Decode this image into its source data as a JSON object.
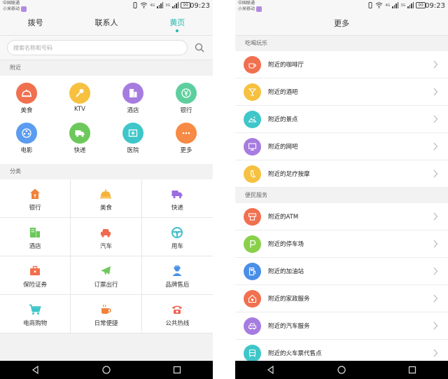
{
  "status_bar": {
    "carrier_line1": "中国联通",
    "carrier_line2": "小米移动",
    "network_tag_1": "4G",
    "network_tag_2": "3G",
    "battery": "99",
    "time": "09:23"
  },
  "left_screen": {
    "tabs": [
      {
        "label": "拨号",
        "active": false
      },
      {
        "label": "联系人",
        "active": false
      },
      {
        "label": "黄页",
        "active": true
      }
    ],
    "search": {
      "placeholder": "搜索名称和号码"
    },
    "nearby_section_title": "附近",
    "nearby_items": [
      {
        "label": "美食",
        "icon": "food-cover-icon",
        "color": "#f0704f"
      },
      {
        "label": "KTV",
        "icon": "microphone-icon",
        "color": "#f6c140"
      },
      {
        "label": "酒店",
        "icon": "hotel-building-icon",
        "color": "#a67ce0"
      },
      {
        "label": "银行",
        "icon": "yen-coin-icon",
        "color": "#5dcf9e"
      },
      {
        "label": "电影",
        "icon": "film-reel-icon",
        "color": "#5b9cf0"
      },
      {
        "label": "快递",
        "icon": "delivery-truck-icon",
        "color": "#6cc85a"
      },
      {
        "label": "医院",
        "icon": "medical-kit-icon",
        "color": "#3fc6c9"
      },
      {
        "label": "更多",
        "icon": "more-dots-icon",
        "color": "#f78a45"
      }
    ],
    "category_section_title": "分类",
    "categories": [
      {
        "label": "银行",
        "icon": "bank-house-icon",
        "color": "#f0823a"
      },
      {
        "label": "美食",
        "icon": "food-cover-icon",
        "color": "#f6b33a"
      },
      {
        "label": "快递",
        "icon": "delivery-truck-icon",
        "color": "#9a6de0"
      },
      {
        "label": "酒店",
        "icon": "hotel-building-icon",
        "color": "#6cc85a"
      },
      {
        "label": "汽车",
        "icon": "car-icon",
        "color": "#f06a4f"
      },
      {
        "label": "用车",
        "icon": "steering-wheel-icon",
        "color": "#3fbfc9"
      },
      {
        "label": "保险证券",
        "icon": "briefcase-icon",
        "color": "#f0704f"
      },
      {
        "label": "订票出行",
        "icon": "airplane-icon",
        "color": "#6cc85a"
      },
      {
        "label": "品牌售后",
        "icon": "service-agent-icon",
        "color": "#4a8ee8"
      },
      {
        "label": "电商购物",
        "icon": "shopping-cart-icon",
        "color": "#3fc6c9"
      },
      {
        "label": "日常便捷",
        "icon": "coffee-cup-icon",
        "color": "#f0823a"
      },
      {
        "label": "公共热线",
        "icon": "telephone-icon",
        "color": "#f0604f"
      }
    ]
  },
  "right_screen": {
    "title": "更多",
    "sections": [
      {
        "title": "吃喝玩乐",
        "items": [
          {
            "label": "附近的咖啡厅",
            "icon": "coffee-cup-icon",
            "color": "#f0704f"
          },
          {
            "label": "附近的酒吧",
            "icon": "cocktail-icon",
            "color": "#f6c140"
          },
          {
            "label": "附近的景点",
            "icon": "landscape-icon",
            "color": "#3fc6c9"
          },
          {
            "label": "附近的网吧",
            "icon": "monitor-icon",
            "color": "#a67ce0"
          },
          {
            "label": "附近的足疗按摩",
            "icon": "foot-icon",
            "color": "#f6c140"
          }
        ]
      },
      {
        "title": "便民服务",
        "items": [
          {
            "label": "附近的ATM",
            "icon": "atm-icon",
            "color": "#f0704f"
          },
          {
            "label": "附近的停车场",
            "icon": "parking-icon",
            "color": "#8ad04a"
          },
          {
            "label": "附近的加油站",
            "icon": "fuel-pump-icon",
            "color": "#4a8ee8"
          },
          {
            "label": "附近的家政服务",
            "icon": "housekeeping-icon",
            "color": "#f0704f"
          },
          {
            "label": "附近的汽车服务",
            "icon": "car-icon",
            "color": "#a67ce0"
          },
          {
            "label": "附近的火车票代售点",
            "icon": "train-icon",
            "color": "#3fc6c9"
          }
        ]
      }
    ]
  },
  "nav": {
    "back_icon": "back-triangle-icon",
    "home_icon": "home-circle-icon",
    "recents_icon": "recents-square-icon"
  }
}
